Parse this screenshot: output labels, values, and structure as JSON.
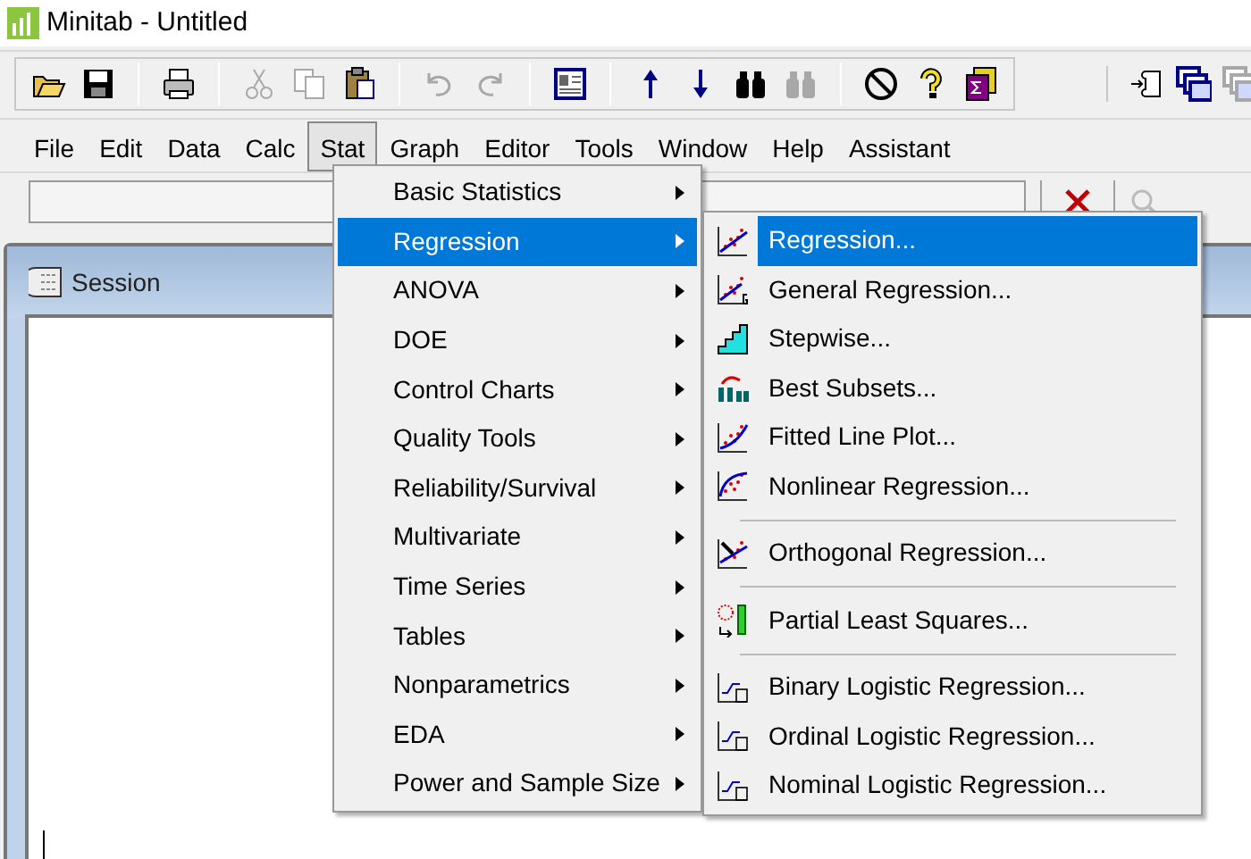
{
  "window": {
    "title": "Minitab - Untitled"
  },
  "toolbar": [
    {
      "kind": "open",
      "disabled": false
    },
    {
      "kind": "save",
      "disabled": false
    },
    {
      "kind": "sep"
    },
    {
      "kind": "print",
      "disabled": false
    },
    {
      "kind": "sep"
    },
    {
      "kind": "cut",
      "disabled": true
    },
    {
      "kind": "copy",
      "disabled": true
    },
    {
      "kind": "paste",
      "disabled": false
    },
    {
      "kind": "sep"
    },
    {
      "kind": "undo",
      "disabled": true
    },
    {
      "kind": "redo",
      "disabled": true
    },
    {
      "kind": "sep"
    },
    {
      "kind": "session",
      "disabled": false
    },
    {
      "kind": "sep"
    },
    {
      "kind": "up",
      "disabled": false
    },
    {
      "kind": "down",
      "disabled": false
    },
    {
      "kind": "find",
      "disabled": false
    },
    {
      "kind": "replace",
      "disabled": true
    },
    {
      "kind": "sep"
    },
    {
      "kind": "cancel",
      "disabled": false
    },
    {
      "kind": "help",
      "disabled": false
    },
    {
      "kind": "stack",
      "disabled": false
    }
  ],
  "toolbar_right": [
    {
      "kind": "append",
      "disabled": false
    },
    {
      "kind": "windows",
      "disabled": false
    },
    {
      "kind": "windows2",
      "disabled": true
    }
  ],
  "menu_bar": [
    {
      "label": "File",
      "selected": false
    },
    {
      "label": "Edit",
      "selected": false
    },
    {
      "label": "Data",
      "selected": false
    },
    {
      "label": "Calc",
      "selected": false
    },
    {
      "label": "Stat",
      "selected": true
    },
    {
      "label": "Graph",
      "selected": false
    },
    {
      "label": "Editor",
      "selected": false
    },
    {
      "label": "Tools",
      "selected": false
    },
    {
      "label": "Window",
      "selected": false
    },
    {
      "label": "Help",
      "selected": false
    },
    {
      "label": "Assistant",
      "selected": false
    }
  ],
  "command_toolbar": {
    "cancel_disabled": false,
    "search_disabled": true
  },
  "session_window": {
    "title": "Session"
  },
  "stat_menu": [
    {
      "label": "Basic Statistics",
      "selected": false
    },
    {
      "label": "Regression",
      "selected": true
    },
    {
      "label": "ANOVA",
      "selected": false
    },
    {
      "label": "DOE",
      "selected": false
    },
    {
      "label": "Control Charts",
      "selected": false
    },
    {
      "label": "Quality Tools",
      "selected": false
    },
    {
      "label": "Reliability/Survival",
      "selected": false
    },
    {
      "label": "Multivariate",
      "selected": false
    },
    {
      "label": "Time Series",
      "selected": false
    },
    {
      "label": "Tables",
      "selected": false
    },
    {
      "label": "Nonparametrics",
      "selected": false
    },
    {
      "label": "EDA",
      "selected": false
    },
    {
      "label": "Power and Sample Size",
      "selected": false
    }
  ],
  "regression_menu": [
    {
      "label": "Regression...",
      "kind": "scatter",
      "selected": true,
      "separator_before": false
    },
    {
      "label": "General Regression...",
      "kind": "scatter-g",
      "selected": false,
      "separator_before": false
    },
    {
      "label": "Stepwise...",
      "kind": "stairs",
      "selected": false,
      "separator_before": false
    },
    {
      "label": "Best Subsets...",
      "kind": "subsets",
      "selected": false,
      "separator_before": false
    },
    {
      "label": "Fitted Line Plot...",
      "kind": "fitted",
      "selected": false,
      "separator_before": false
    },
    {
      "label": "Nonlinear Regression...",
      "kind": "curve",
      "selected": false,
      "separator_before": false
    },
    {
      "label": "Orthogonal Regression...",
      "kind": "orthogonal",
      "selected": false,
      "separator_before": true
    },
    {
      "label": "Partial Least Squares...",
      "kind": "pls",
      "selected": false,
      "separator_before": true
    },
    {
      "label": "Binary Logistic Regression...",
      "kind": "logistic-b",
      "selected": false,
      "separator_before": true
    },
    {
      "label": "Ordinal Logistic Regression...",
      "kind": "logistic-o",
      "selected": false,
      "separator_before": false
    },
    {
      "label": "Nominal Logistic Regression...",
      "kind": "logistic-n",
      "selected": false,
      "separator_before": false
    }
  ]
}
